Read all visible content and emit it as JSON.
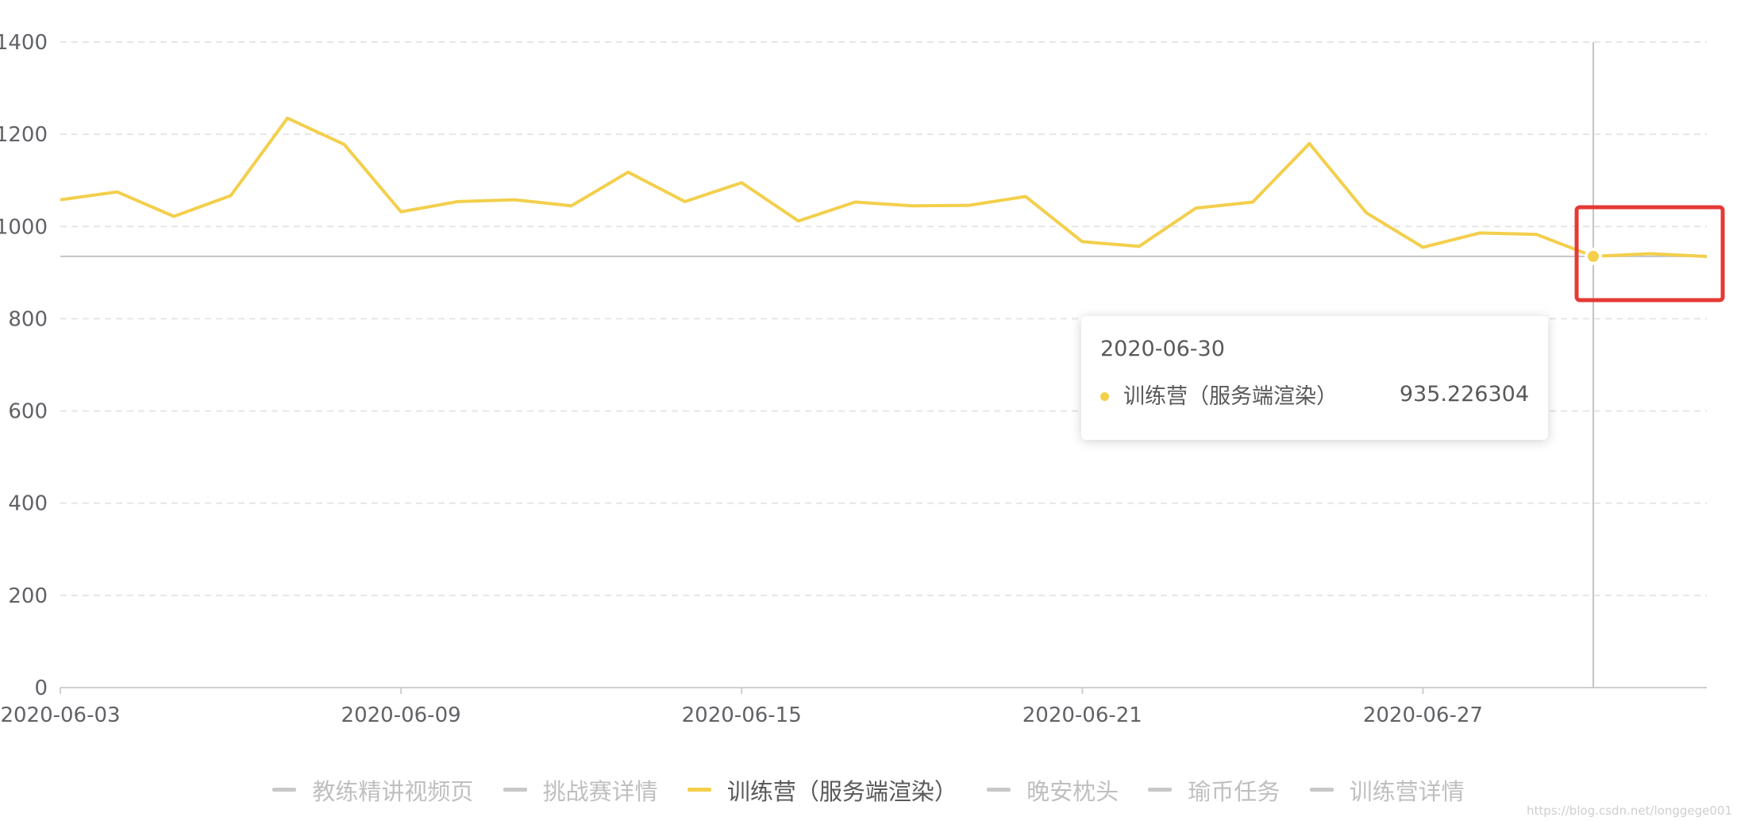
{
  "chart_data": {
    "type": "line",
    "x": [
      "2020-06-03",
      "2020-06-04",
      "2020-06-05",
      "2020-06-06",
      "2020-06-07",
      "2020-06-08",
      "2020-06-09",
      "2020-06-10",
      "2020-06-11",
      "2020-06-12",
      "2020-06-13",
      "2020-06-14",
      "2020-06-15",
      "2020-06-16",
      "2020-06-17",
      "2020-06-18",
      "2020-06-19",
      "2020-06-20",
      "2020-06-21",
      "2020-06-22",
      "2020-06-23",
      "2020-06-24",
      "2020-06-25",
      "2020-06-26",
      "2020-06-27",
      "2020-06-28",
      "2020-06-29",
      "2020-06-30",
      "2020-07-01",
      "2020-07-02"
    ],
    "x_tick_labels": [
      "2020-06-03",
      "2020-06-09",
      "2020-06-15",
      "2020-06-21",
      "2020-06-27"
    ],
    "y_tick_labels": [
      "0",
      "200",
      "400",
      "600",
      "800",
      "1000",
      "1200",
      "1400"
    ],
    "ylim": [
      0,
      1400
    ],
    "series": [
      {
        "name": "训练营（服务端渲染）",
        "color": "#f3cf4c",
        "values": [
          1058,
          1075,
          1022,
          1067,
          1235,
          1178,
          1032,
          1054,
          1058,
          1045,
          1118,
          1054,
          1095,
          1012,
          1053,
          1045,
          1046,
          1065,
          967,
          957,
          1040,
          1053,
          1180,
          1030,
          955,
          986,
          983,
          935.226304,
          941,
          935
        ]
      }
    ],
    "reference_line": 935.226304,
    "hover_index": 27,
    "grid": true,
    "legend_position": "bottom",
    "legend": [
      {
        "name": "教练精讲视频页",
        "active": false
      },
      {
        "name": "挑战赛详情",
        "active": false
      },
      {
        "name": "训练营（服务端渲染）",
        "active": true
      },
      {
        "name": "晚安枕头",
        "active": false
      },
      {
        "name": "瑜币任务",
        "active": false
      },
      {
        "name": "训练营详情",
        "active": false
      }
    ],
    "tooltip": {
      "title": "2020-06-30",
      "series_name": "训练营（服务端渲染）",
      "value": "935.226304"
    }
  },
  "annotation_color": "#e53935",
  "watermark": "https://blog.csdn.net/longgege001"
}
